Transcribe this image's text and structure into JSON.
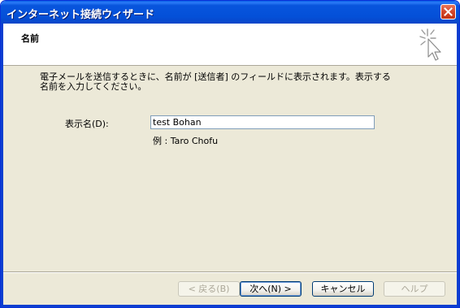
{
  "window": {
    "title": "インターネット接続ウィザード"
  },
  "header": {
    "title": "名前"
  },
  "content": {
    "description": "電子メールを送信するときに、名前が [送信者] のフィールドに表示されます。表示する名前を入力してください。",
    "display_name_label": "表示名(D):",
    "display_name_value": "test Bohan",
    "example": "例 : Taro Chofu"
  },
  "buttons": {
    "back": "< 戻る(B)",
    "next": "次へ(N) >",
    "cancel": "キャンセル",
    "help": "ヘルプ"
  },
  "colors": {
    "titlebar": "#0450d8",
    "window_bg": "#ece9d8",
    "close_button": "#d4462a"
  },
  "icons": [
    "close-icon",
    "wizard-sparkle-cursor-icon"
  ]
}
